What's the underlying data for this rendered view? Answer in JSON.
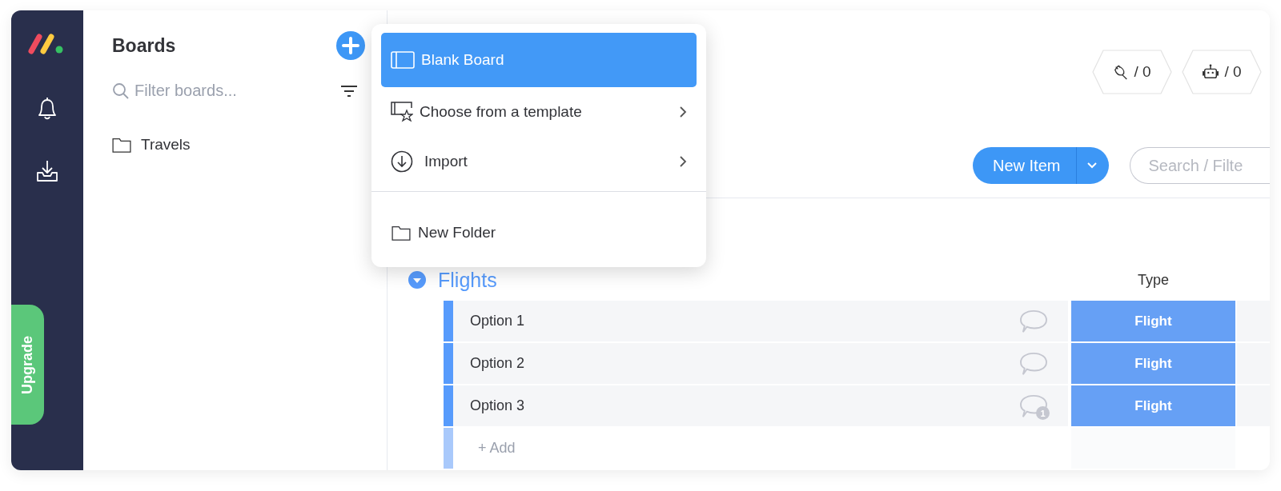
{
  "sidebar": {
    "upgrade_label": "Upgrade"
  },
  "boards_panel": {
    "title": "Boards",
    "filter": {
      "placeholder": "Filter boards..."
    },
    "items": [
      {
        "label": "Travels",
        "kind": "folder"
      }
    ]
  },
  "menu": {
    "sections": [
      [
        {
          "label": "Blank Board",
          "kind": "board",
          "selected": true,
          "submenu": false
        },
        {
          "label": "Choose from a template",
          "kind": "template",
          "selected": false,
          "submenu": true
        },
        {
          "label": "Import",
          "kind": "import",
          "selected": false,
          "submenu": true
        }
      ],
      [
        {
          "label": "New Folder",
          "kind": "folder",
          "selected": false,
          "submenu": false
        }
      ]
    ]
  },
  "counters": [
    {
      "kind": "integration",
      "label": "/ 0"
    },
    {
      "kind": "robot",
      "label": "/ 0"
    }
  ],
  "toolbar": {
    "new_item_label": "New Item",
    "search": {
      "placeholder": "Search / Filte"
    }
  },
  "group": {
    "title": "Flights",
    "columns": [
      "Type"
    ],
    "rows": [
      {
        "name": "Option 1",
        "comments": "",
        "type": "Flight"
      },
      {
        "name": "Option 2",
        "comments": "",
        "type": "Flight"
      },
      {
        "name": "Option 3",
        "comments": "1",
        "type": "Flight"
      }
    ],
    "add_label": "+ Add"
  }
}
